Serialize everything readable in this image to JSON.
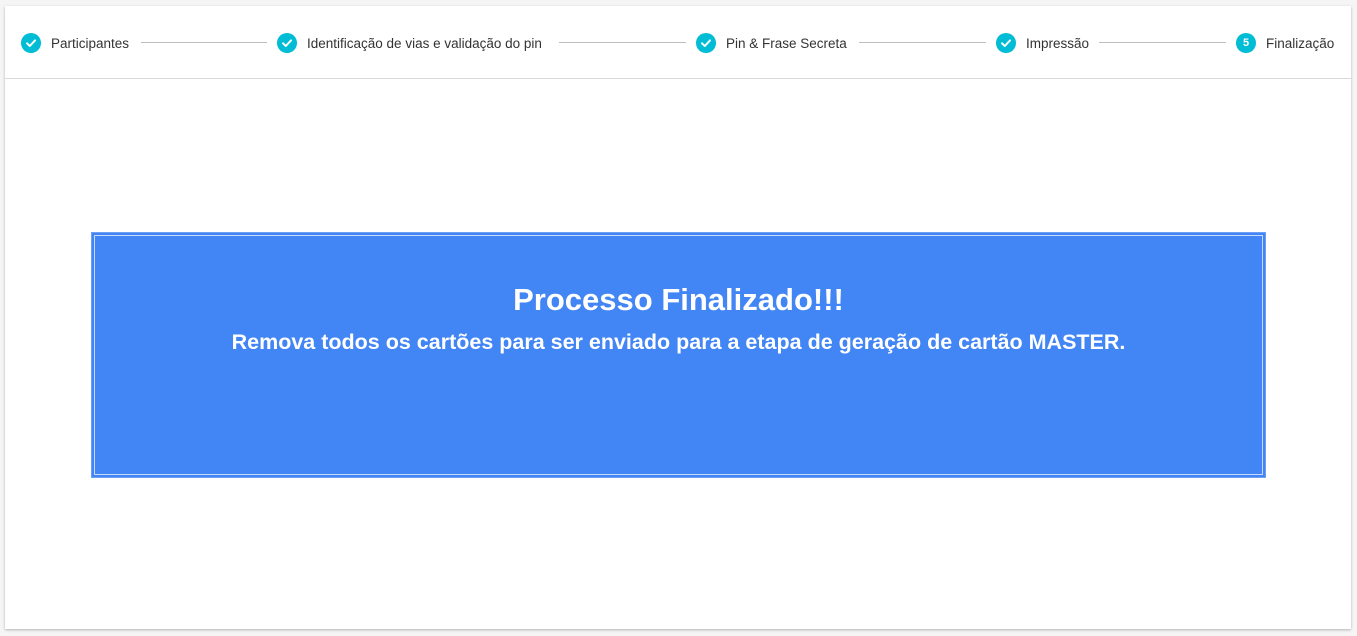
{
  "stepper": {
    "steps": [
      {
        "label": "Participantes",
        "state": "completed",
        "icon": "check-icon"
      },
      {
        "label": "Identificação de vias e validação do pin",
        "state": "completed",
        "icon": "check-icon"
      },
      {
        "label": "Pin & Frase Secreta",
        "state": "completed",
        "icon": "check-icon"
      },
      {
        "label": "Impressão",
        "state": "completed",
        "icon": "check-icon"
      },
      {
        "label": "Finalização",
        "state": "active",
        "number": "5"
      }
    ]
  },
  "banner": {
    "title": "Processo Finalizado!!!",
    "message": "Remova todos os cartões para ser enviado para a etapa de geração de cartão MASTER."
  },
  "colors": {
    "accent": "#00bcd4",
    "banner_bg": "#4285f4",
    "text": "#333333"
  }
}
